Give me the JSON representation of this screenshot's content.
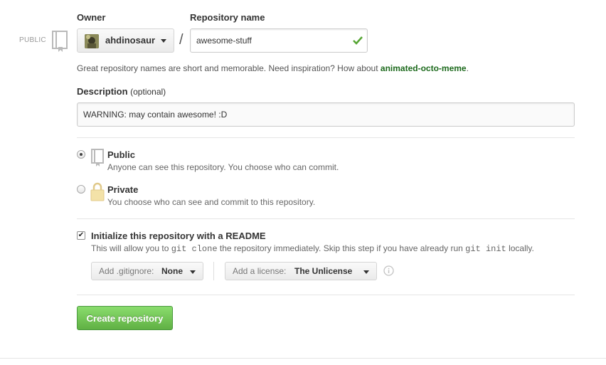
{
  "owner": {
    "label": "Owner",
    "selected": "ahdinosaur",
    "visibility_tag": "PUBLIC"
  },
  "repo": {
    "label": "Repository name",
    "separator": "/",
    "value": "awesome-stuff"
  },
  "hint": {
    "text": "Great repository names are short and memorable. Need inspiration? How about ",
    "suggestion": "animated-octo-meme",
    "end": "."
  },
  "description": {
    "label": "Description",
    "optional": "(optional)",
    "value": "WARNING: may contain awesome! :D"
  },
  "visibility": {
    "public_title": "Public",
    "public_desc": "Anyone can see this repository. You choose who can commit.",
    "private_title": "Private",
    "private_desc": "You choose who can see and commit to this repository.",
    "selected": "public"
  },
  "readme": {
    "label": "Initialize this repository with a README",
    "desc_1": "This will allow you to ",
    "code_1": "git clone",
    "desc_2": " the repository immediately. Skip this step if you have already run ",
    "code_2": "git init",
    "desc_3": " locally.",
    "checked": true
  },
  "gitignore": {
    "prefix": "Add .gitignore:",
    "value": "None"
  },
  "license": {
    "prefix": "Add a license:",
    "value": "The Unlicense"
  },
  "actions": {
    "create_label": "Create repository"
  },
  "colors": {
    "accent_green": "#55a532",
    "suggestion_green": "#1d6a1d",
    "button_green": "#60b044"
  },
  "icons": {
    "repo": "repo-book-icon",
    "lock": "lock-icon",
    "check": "check-icon",
    "info": "info-icon",
    "avatar": "avatar"
  }
}
